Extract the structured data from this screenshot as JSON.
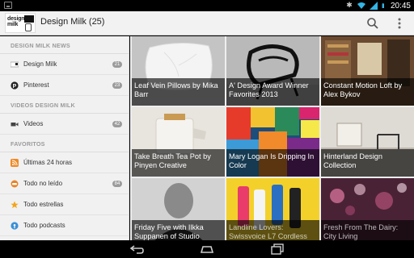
{
  "status_bar": {
    "time": "20:45"
  },
  "action_bar": {
    "logo_text": "design milk",
    "title": "Design Milk (25)"
  },
  "sidebar": {
    "sections": [
      {
        "header": "DESIGN MILK NEWS",
        "items": [
          {
            "label": "Design Milk",
            "count": "21",
            "icon": "feed-favicon"
          },
          {
            "label": "Pinterest",
            "count": "23",
            "icon": "pinterest-icon"
          }
        ]
      },
      {
        "header": "VIDEOS DESIGN MILK",
        "items": [
          {
            "label": "Videos",
            "count": "42",
            "icon": "video-camera-icon"
          }
        ]
      },
      {
        "header": "FAVORITOS",
        "items": [
          {
            "label": "Últimas 24 horas",
            "count": "",
            "icon": "rss-icon"
          },
          {
            "label": "Todo no leído",
            "count": "84",
            "icon": "unread-icon"
          },
          {
            "label": "Todo estrellas",
            "count": "",
            "icon": "star-icon"
          },
          {
            "label": "Todo podcasts",
            "count": "",
            "icon": "podcast-icon"
          }
        ]
      }
    ]
  },
  "articles": [
    {
      "title": "Leaf Vein Pillows by Mika Barr",
      "bg": "#c9c9c9"
    },
    {
      "title": "A' Design Award Winner Favorites 2013",
      "bg": "#b5b5b5"
    },
    {
      "title": "Constant Motion Loft by Alex Bykov",
      "bg": "#6b4d33"
    },
    {
      "title": "Take Breath Tea Pot by Pinyen Creative",
      "bg": "#e6e2dc"
    },
    {
      "title": "Mary Logan Is Dripping In Color",
      "bg": "#2f5c86"
    },
    {
      "title": "Hinterland Design Collection",
      "bg": "#d9d6d1"
    },
    {
      "title": "Friday Five with Ilkka Suppanen of Studio",
      "bg": "#9a9a9a"
    },
    {
      "title": "Landline Lovers: Swissvoice L7 Cordless",
      "bg": "#f2d12c"
    },
    {
      "title": "Fresh From The Dairy: City Living",
      "bg": "#5a2b3e"
    }
  ]
}
